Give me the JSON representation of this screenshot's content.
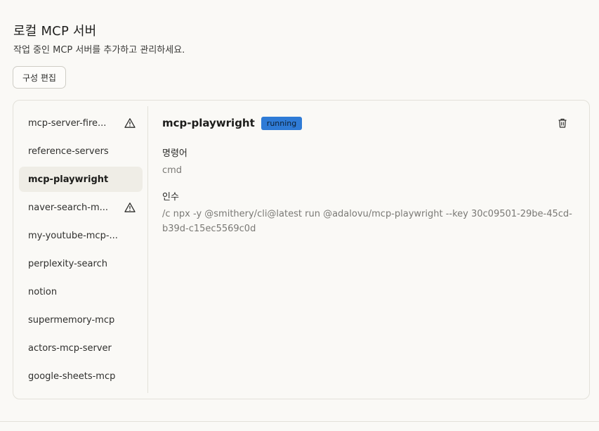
{
  "header": {
    "title": "로컬 MCP 서버",
    "subtitle": "작업 중인 MCP 서버를 추가하고 관리하세요.",
    "edit_config_label": "구성 편집"
  },
  "servers": [
    {
      "name": "mcp-server-fire...",
      "warning": true,
      "active": false
    },
    {
      "name": "reference-servers",
      "warning": false,
      "active": false
    },
    {
      "name": "mcp-playwright",
      "warning": false,
      "active": true
    },
    {
      "name": "naver-search-m...",
      "warning": true,
      "active": false
    },
    {
      "name": "my-youtube-mcp-...",
      "warning": false,
      "active": false
    },
    {
      "name": "perplexity-search",
      "warning": false,
      "active": false
    },
    {
      "name": "notion",
      "warning": false,
      "active": false
    },
    {
      "name": "supermemory-mcp",
      "warning": false,
      "active": false
    },
    {
      "name": "actors-mcp-server",
      "warning": false,
      "active": false
    },
    {
      "name": "google-sheets-mcp",
      "warning": false,
      "active": false
    }
  ],
  "detail": {
    "title": "mcp-playwright",
    "status": "running",
    "command_label": "명령어",
    "command_value": "cmd",
    "args_label": "인수",
    "args_value": "/c npx -y @smithery/cli@latest run @adalovu/mcp-playwright --key 30c09501-29be-45cd-b39d-c15ec5569c0d"
  },
  "icons": {
    "warning": "warning-triangle-icon",
    "delete": "trash-icon"
  },
  "colors": {
    "badge_bg": "#2f7bd6",
    "active_item_bg": "#efede6",
    "page_bg": "#faf9f6"
  }
}
